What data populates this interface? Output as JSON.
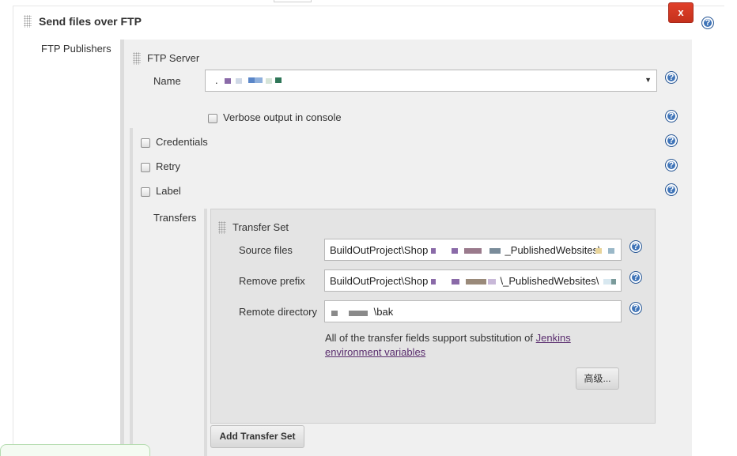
{
  "section": {
    "title": "Send files over FTP",
    "delete_label": "x",
    "help_glyph": "?"
  },
  "publishers": {
    "label": "FTP Publishers",
    "server_heading": "FTP Server",
    "name_label": "Name",
    "name_value": ".",
    "verbose_label": "Verbose output in console",
    "credentials_label": "Credentials",
    "retry_label": "Retry",
    "label_label": "Label",
    "transfers_label": "Transfers"
  },
  "transfer_set": {
    "heading": "Transfer Set",
    "source_files_label": "Source files",
    "source_files_value_prefix": "BuildOutProject\\Shop",
    "source_files_value_suffix": "_PublishedWebsites\\",
    "remove_prefix_label": "Remove prefix",
    "remove_prefix_value_prefix": "BuildOutProject\\Shop",
    "remove_prefix_value_suffix": "\\_PublishedWebsites\\",
    "remote_dir_label": "Remote directory",
    "remote_dir_value": "\\bak",
    "info_text": "All of the transfer fields support substitution of ",
    "info_link": "Jenkins environment variables",
    "advanced_button": "高级...",
    "add_button": "Add Transfer Set"
  },
  "colors": {
    "accent_red": "#d43a24",
    "help_blue": "#3f74b8",
    "link_purple": "#5a2d6e",
    "panel_gray": "#f0f0f0"
  }
}
